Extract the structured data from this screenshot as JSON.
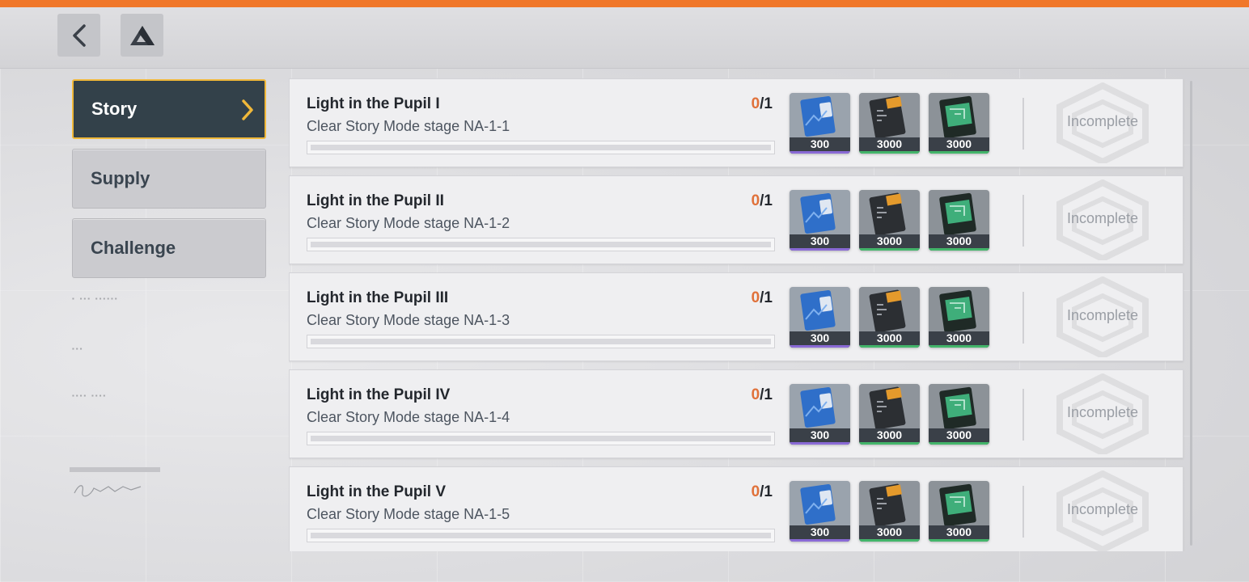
{
  "header": {
    "back_icon": "chevron-left-icon",
    "home_icon": "triangle-logo-icon"
  },
  "sidebar": {
    "tabs": [
      {
        "label": "Story",
        "active": true
      },
      {
        "label": "Supply",
        "active": false
      },
      {
        "label": "Challenge",
        "active": false
      }
    ]
  },
  "colors": {
    "accent_orange": "#f0772a",
    "active_tab_bg": "#33414a",
    "active_tab_border": "#f0b83a",
    "progress_count": "#e0713a",
    "reward_purple": "#8a6ad6",
    "reward_green": "#43b56a"
  },
  "tasks": [
    {
      "title": "Light in the Pupil I",
      "description": "Clear Story Mode stage NA-1-1",
      "progress_current": "0",
      "progress_total": "/1",
      "progress_fraction": 0,
      "rewards": [
        {
          "icon": "blue-card-icon",
          "quantity": "300",
          "rarity": "purple"
        },
        {
          "icon": "orange-ticket-icon",
          "quantity": "3000",
          "rarity": "green"
        },
        {
          "icon": "green-chip-icon",
          "quantity": "3000",
          "rarity": "green"
        }
      ],
      "status": "Incomplete"
    },
    {
      "title": "Light in the Pupil II",
      "description": "Clear Story Mode stage NA-1-2",
      "progress_current": "0",
      "progress_total": "/1",
      "progress_fraction": 0,
      "rewards": [
        {
          "icon": "blue-card-icon",
          "quantity": "300",
          "rarity": "purple"
        },
        {
          "icon": "orange-ticket-icon",
          "quantity": "3000",
          "rarity": "green"
        },
        {
          "icon": "green-chip-icon",
          "quantity": "3000",
          "rarity": "green"
        }
      ],
      "status": "Incomplete"
    },
    {
      "title": "Light in the Pupil III",
      "description": "Clear Story Mode stage NA-1-3",
      "progress_current": "0",
      "progress_total": "/1",
      "progress_fraction": 0,
      "rewards": [
        {
          "icon": "blue-card-icon",
          "quantity": "300",
          "rarity": "purple"
        },
        {
          "icon": "orange-ticket-icon",
          "quantity": "3000",
          "rarity": "green"
        },
        {
          "icon": "green-chip-icon",
          "quantity": "3000",
          "rarity": "green"
        }
      ],
      "status": "Incomplete"
    },
    {
      "title": "Light in the Pupil IV",
      "description": "Clear Story Mode stage NA-1-4",
      "progress_current": "0",
      "progress_total": "/1",
      "progress_fraction": 0,
      "rewards": [
        {
          "icon": "blue-card-icon",
          "quantity": "300",
          "rarity": "purple"
        },
        {
          "icon": "orange-ticket-icon",
          "quantity": "3000",
          "rarity": "green"
        },
        {
          "icon": "green-chip-icon",
          "quantity": "3000",
          "rarity": "green"
        }
      ],
      "status": "Incomplete"
    },
    {
      "title": "Light in the Pupil V",
      "description": "Clear Story Mode stage NA-1-5",
      "progress_current": "0",
      "progress_total": "/1",
      "progress_fraction": 0,
      "rewards": [
        {
          "icon": "blue-card-icon",
          "quantity": "300",
          "rarity": "purple"
        },
        {
          "icon": "orange-ticket-icon",
          "quantity": "3000",
          "rarity": "green"
        },
        {
          "icon": "green-chip-icon",
          "quantity": "3000",
          "rarity": "green"
        }
      ],
      "status": "Incomplete"
    }
  ]
}
